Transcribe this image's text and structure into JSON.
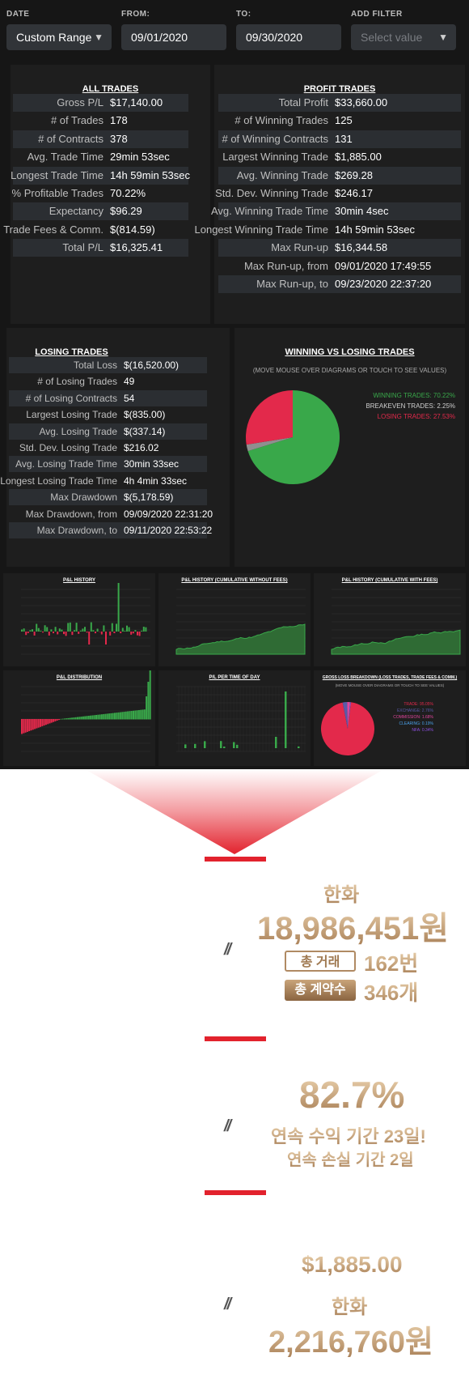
{
  "filters": {
    "date_label": "DATE",
    "date_value": "Custom Range",
    "from_label": "FROM:",
    "from_value": "09/01/2020",
    "to_label": "TO:",
    "to_value": "09/30/2020",
    "add_filter_label": "ADD FILTER",
    "add_filter_placeholder": "Select value"
  },
  "all_trades": {
    "title": "ALL TRADES",
    "rows": [
      {
        "k": "Gross P/L",
        "v": "$17,140.00"
      },
      {
        "k": "# of Trades",
        "v": "178"
      },
      {
        "k": "# of Contracts",
        "v": "378"
      },
      {
        "k": "Avg. Trade Time",
        "v": "29min 53sec"
      },
      {
        "k": "Longest Trade Time",
        "v": "14h 59min 53sec"
      },
      {
        "k": "% Profitable Trades",
        "v": "70.22%"
      },
      {
        "k": "Expectancy",
        "v": "$96.29"
      },
      {
        "k": "Trade Fees & Comm.",
        "v": "$(814.59)"
      },
      {
        "k": "Total P/L",
        "v": "$16,325.41"
      }
    ]
  },
  "profit_trades": {
    "title": "PROFIT TRADES",
    "rows": [
      {
        "k": "Total Profit",
        "v": "$33,660.00"
      },
      {
        "k": "# of Winning Trades",
        "v": "125"
      },
      {
        "k": "# of Winning Contracts",
        "v": "131"
      },
      {
        "k": "Largest Winning Trade",
        "v": "$1,885.00"
      },
      {
        "k": "Avg. Winning Trade",
        "v": "$269.28"
      },
      {
        "k": "Std. Dev. Winning Trade",
        "v": "$246.17"
      },
      {
        "k": "Avg. Winning Trade Time",
        "v": "30min 4sec"
      },
      {
        "k": "Longest Winning Trade Time",
        "v": "14h 59min 53sec"
      },
      {
        "k": "Max Run-up",
        "v": "$16,344.58"
      },
      {
        "k": "Max Run-up, from",
        "v": "09/01/2020 17:49:55"
      },
      {
        "k": "Max Run-up, to",
        "v": "09/23/2020 22:37:20"
      }
    ]
  },
  "losing_trades": {
    "title": "LOSING TRADES",
    "rows": [
      {
        "k": "Total Loss",
        "v": "$(16,520.00)"
      },
      {
        "k": "# of Losing Trades",
        "v": "49"
      },
      {
        "k": "# of Losing Contracts",
        "v": "54"
      },
      {
        "k": "Largest Losing Trade",
        "v": "$(835.00)"
      },
      {
        "k": "Avg. Losing Trade",
        "v": "$(337.14)"
      },
      {
        "k": "Std. Dev. Losing Trade",
        "v": "$216.02"
      },
      {
        "k": "Avg. Losing Trade Time",
        "v": "30min 33sec"
      },
      {
        "k": "Longest Losing Trade Time",
        "v": "4h 4min 33sec"
      },
      {
        "k": "Max Drawdown",
        "v": "$(5,178.59)"
      },
      {
        "k": "Max Drawdown, from",
        "v": "09/09/2020 22:31:20"
      },
      {
        "k": "Max Drawdown, to",
        "v": "09/11/2020 22:53:22"
      }
    ]
  },
  "win_loss": {
    "title": "WINNING VS LOSING TRADES",
    "note": "(MOVE MOUSE OVER DIAGRAMS OR TOUCH TO SEE VALUES)",
    "legend": [
      "WINNING TRADES: 70.22%",
      "BREAKEVEN TRADES: 2.25%",
      "LOSING TRADES: 27.53%"
    ]
  },
  "mini_titles": {
    "pl_history": "P&L HISTORY",
    "pl_cum_without": "P&L HISTORY (CUMULATIVE WITHOUT FEES)",
    "pl_cum_with": "P&L HISTORY (CUMULATIVE WITH FEES)",
    "pl_distribution": "P&L DISTRIBUTION",
    "pl_time_of_day": "P/L PER TIME OF DAY",
    "gross_loss": "GROSS LOSS BREAKDOWN (LOSS TRADES, TRADE FEES & COMM.)",
    "gross_loss_note": "(MOVE MOUSE OVER DIAGRAMS OR TOUCH TO SEE VALUES)",
    "gross_loss_legend": [
      "TRADE: 95.05%",
      "EXCHANGE: 2.76%",
      "COMMISSION: 1.68%",
      "CLEARING: 0.19%",
      "NFA: 0.34%"
    ]
  },
  "colors": {
    "win": "#39a84a",
    "loss": "#e3294b",
    "breakeven": "#8f8f8f",
    "accent_red": "#e2222d",
    "gold": "#a57b52"
  },
  "chart_data": [
    {
      "type": "pie",
      "title": "WINNING VS LOSING TRADES",
      "labels": [
        "WINNING TRADES",
        "BREAKEVEN TRADES",
        "LOSING TRADES"
      ],
      "values": [
        70.22,
        2.25,
        27.53
      ]
    },
    {
      "type": "pie",
      "title": "GROSS LOSS BREAKDOWN (LOSS TRADES, TRADE FEES & COMM.)",
      "labels": [
        "TRADE",
        "EXCHANGE",
        "COMMISSION",
        "CLEARING",
        "NFA"
      ],
      "values": [
        95.05,
        2.76,
        1.68,
        0.19,
        0.34
      ]
    }
  ],
  "promo": {
    "section1": {
      "label": "한화",
      "amount": "18,986,451원",
      "trades_label": "총 거래",
      "trades_value": "162번",
      "contracts_label": "총 계약수",
      "contracts_value": "346개"
    },
    "section2": {
      "percent": "82.7%",
      "line1": "연속 수익 기간 23일!",
      "line2": "연속 손실 기간 2일"
    },
    "section3": {
      "usd": "$1,885.00",
      "label": "한화",
      "amount": "2,216,760원"
    },
    "slash": "//"
  }
}
